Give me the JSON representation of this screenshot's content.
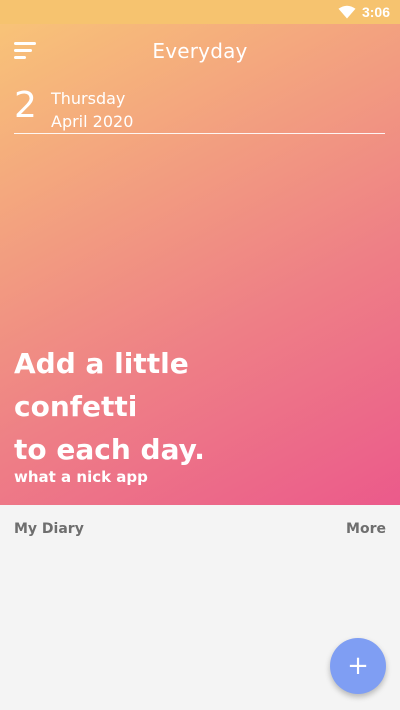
{
  "status_bar": {
    "time": "3:06"
  },
  "header": {
    "title": "Everyday"
  },
  "date": {
    "day": "2",
    "weekday": "Thursday",
    "month_year": "April 2020"
  },
  "hero": {
    "tagline_lines": [
      "Add a little",
      "confetti",
      "to each day."
    ],
    "subtitle": "what a nick app"
  },
  "diary": {
    "section_title": "My Diary",
    "more_label": "More"
  },
  "fab": {
    "label": "+"
  },
  "colors": {
    "status_bar": "#f6c36f",
    "gradient_start": "#f8c378",
    "gradient_end": "#eb5a8b",
    "fab": "#7f9ef3",
    "page_background": "#f4f4f4"
  }
}
